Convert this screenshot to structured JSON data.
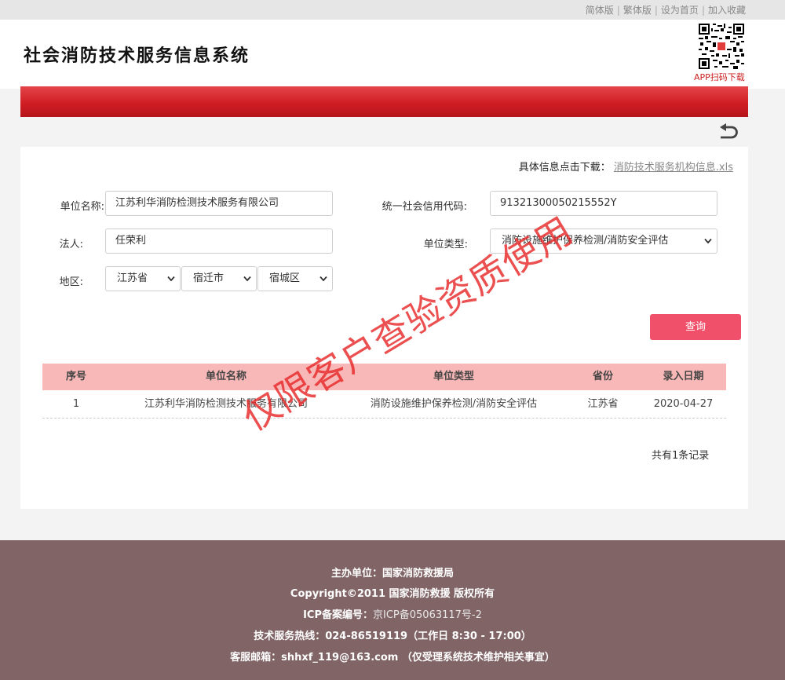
{
  "top_links": [
    "简体版",
    "繁体版",
    "设为首页",
    "加入收藏"
  ],
  "header": {
    "title": "社会消防技术服务信息系统",
    "qr_caption": "APP扫码下载"
  },
  "download": {
    "label": "具体信息点击下载：",
    "link_text": "消防技术服务机构信息.xls"
  },
  "form": {
    "unit_name_label": "单位名称:",
    "unit_name_value": "江苏利华消防检测技术服务有限公司",
    "credit_code_label": "统一社会信用代码:",
    "credit_code_value": "91321300050215552Y",
    "legal_person_label": "法人:",
    "legal_person_value": "任荣利",
    "unit_type_label": "单位类型:",
    "unit_type_value": "消防设施维护保养检测/消防安全评估",
    "region_label": "地区:",
    "province": "江苏省",
    "city": "宿迁市",
    "district": "宿城区",
    "query_button": "查询"
  },
  "table": {
    "headers": [
      "序号",
      "单位名称",
      "单位类型",
      "省份",
      "录入日期"
    ],
    "rows": [
      [
        "1",
        "江苏利华消防检测技术服务有限公司",
        "消防设施维护保养检测/消防安全评估",
        "江苏省",
        "2020-04-27"
      ]
    ],
    "total_text": "共有1条记录"
  },
  "watermark": "仅限客户查验资质使用",
  "footer": {
    "host_label": "主办单位：",
    "host_value": "国家消防救援局",
    "copyright": "Copyright©2011 国家消防救援 版权所有",
    "icp_label": "ICP备案编号：",
    "icp_value": "京ICP备05063117号-2",
    "hotline": "技术服务热线：024-86519119（工作日 8:30 - 17:00）",
    "email": "客服邮箱：shhxf_119@163.com （仅受理系统技术维护相关事宜）"
  },
  "colors": {
    "brand_red": "#d01e24",
    "query_button": "#f0506a",
    "table_header": "#f8b8b8",
    "footer_bg": "#806466",
    "watermark": "#e62828"
  },
  "icons": [
    "back-arrow-icon",
    "qr-code-icon",
    "chevron-down-icon"
  ]
}
